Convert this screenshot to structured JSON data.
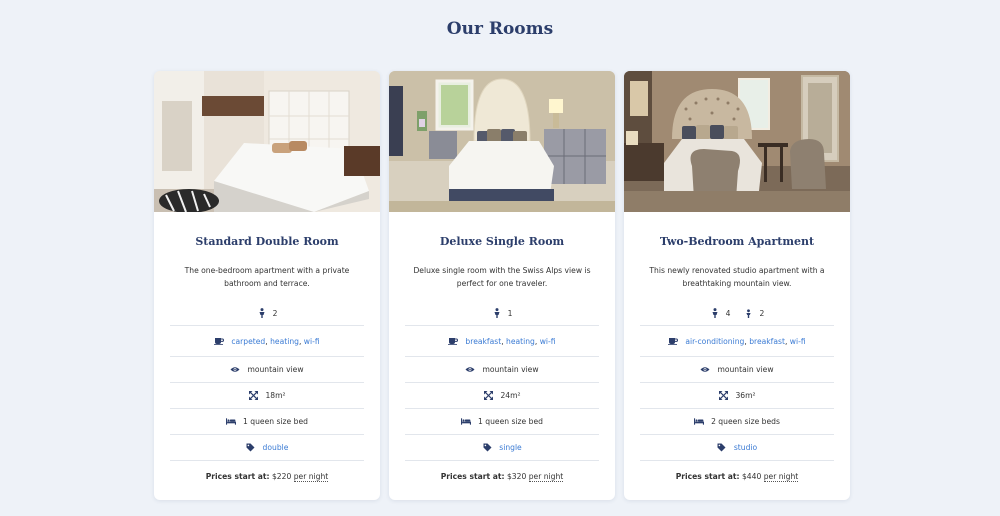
{
  "page": {
    "title": "Our Rooms"
  },
  "colors": {
    "background": "#eef2f8",
    "title": "#2c3e6b",
    "link": "#3b7bd4",
    "icon": "#2c3e6b"
  },
  "rooms": [
    {
      "name": "Standard Double Room",
      "description": "The one-bedroom apartment with a private bathroom and terrace.",
      "occupancy": [
        {
          "icon": "person-icon",
          "count": "2"
        }
      ],
      "amenities": [
        "carpeted",
        "heating",
        "wi-fi"
      ],
      "view": "mountain view",
      "size": "18m²",
      "beds": "1 queen size bed",
      "tag": "double",
      "price_label": "Prices start at:",
      "price": "$220",
      "price_unit": "per night"
    },
    {
      "name": "Deluxe Single Room",
      "description": "Deluxe single room with the Swiss Alps view is perfect for one traveler.",
      "occupancy": [
        {
          "icon": "person-icon",
          "count": "1"
        }
      ],
      "amenities": [
        "breakfast",
        "heating",
        "wi-fi"
      ],
      "view": "mountain view",
      "size": "24m²",
      "beds": "1 queen size bed",
      "tag": "single",
      "price_label": "Prices start at:",
      "price": "$320",
      "price_unit": "per night"
    },
    {
      "name": "Two-Bedroom Apartment",
      "description": "This newly renovated studio apartment with a breathtaking mountain view.",
      "occupancy": [
        {
          "icon": "person-icon",
          "count": "4"
        },
        {
          "icon": "child-icon",
          "count": "2"
        }
      ],
      "amenities": [
        "air-conditioning",
        "breakfast",
        "wi-fi"
      ],
      "view": "mountain view",
      "size": "36m²",
      "beds": "2 queen size beds",
      "tag": "studio",
      "price_label": "Prices start at:",
      "price": "$440",
      "price_unit": "per night"
    }
  ]
}
